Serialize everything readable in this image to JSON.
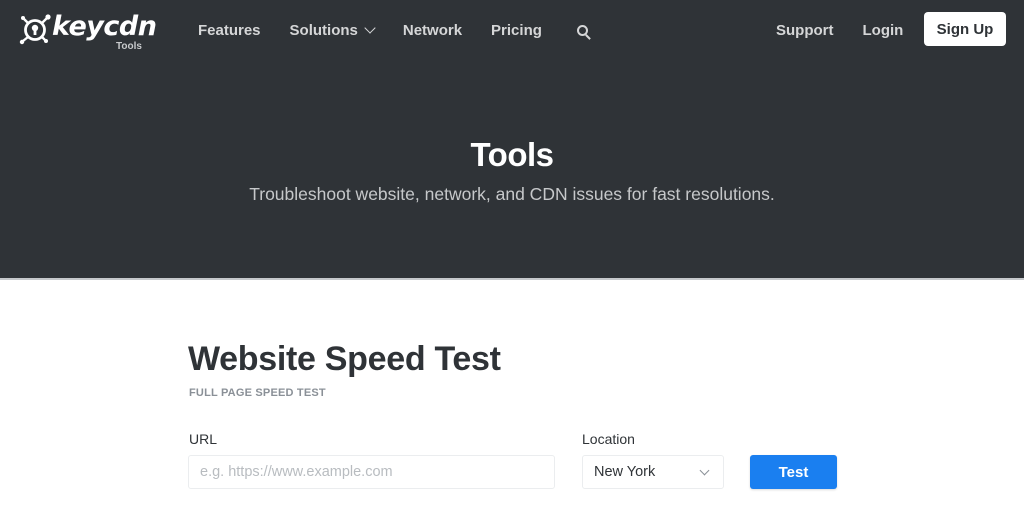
{
  "brand": {
    "name": "keycdn",
    "subtitle": "Tools",
    "logo_icon": "keycdn-keyhole-logo-icon"
  },
  "nav": {
    "left": [
      {
        "label": "Features"
      },
      {
        "label": "Solutions",
        "has_dropdown": true,
        "dropdown_icon": "chevron-down-icon"
      },
      {
        "label": "Network"
      },
      {
        "label": "Pricing"
      }
    ],
    "search_icon": "search-icon",
    "right": [
      {
        "label": "Support"
      },
      {
        "label": "Login"
      }
    ],
    "signup_label": "Sign Up"
  },
  "hero": {
    "title": "Tools",
    "subtitle": "Troubleshoot website, network, and CDN issues for fast resolutions."
  },
  "main": {
    "title": "Website Speed Test",
    "subtitle": "FULL PAGE SPEED TEST",
    "url_field": {
      "label": "URL",
      "value": "",
      "placeholder": "e.g. https://www.example.com"
    },
    "location_field": {
      "label": "Location",
      "selected": "New York"
    },
    "test_button_label": "Test"
  },
  "colors": {
    "header_bg": "#2f3337",
    "accent_blue": "#1a7ff0",
    "text_dark": "#2f3337",
    "muted": "#8a9097"
  }
}
